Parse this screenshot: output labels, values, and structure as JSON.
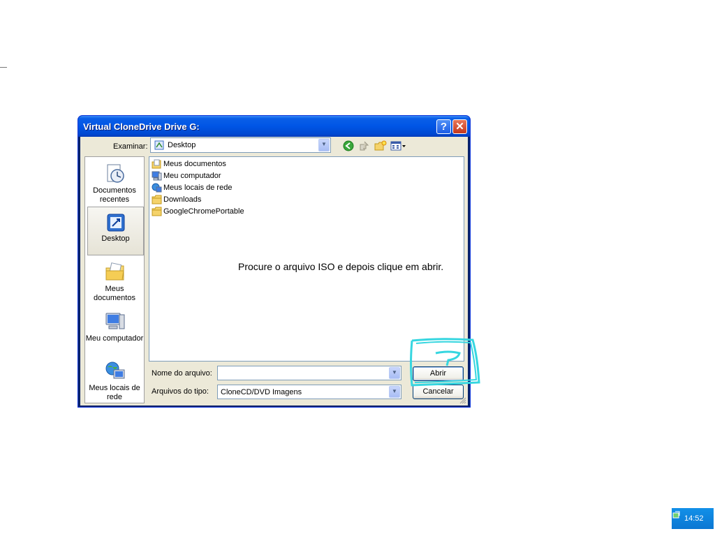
{
  "window": {
    "title": "Virtual CloneDrive Drive G:",
    "help_symbol": "?",
    "close_symbol": "✕"
  },
  "lookin": {
    "label": "Examinar:",
    "value": "Desktop"
  },
  "places": [
    {
      "label": "Documentos recentes",
      "icon": "recent-documents-icon"
    },
    {
      "label": "Desktop",
      "icon": "desktop-icon",
      "selected": true
    },
    {
      "label": "Meus documentos",
      "icon": "my-documents-icon"
    },
    {
      "label": "Meu computador",
      "icon": "my-computer-icon"
    },
    {
      "label": "Meus locais de rede",
      "icon": "network-places-icon"
    }
  ],
  "files": [
    {
      "name": "Meus documentos",
      "icon": "my-documents-icon"
    },
    {
      "name": "Meu computador",
      "icon": "my-computer-icon"
    },
    {
      "name": "Meus locais de rede",
      "icon": "network-places-icon"
    },
    {
      "name": "Downloads",
      "icon": "folder-icon"
    },
    {
      "name": "GoogleChromePortable",
      "icon": "folder-icon"
    }
  ],
  "instruction": "Procure o arquivo ISO e depois clique em abrir.",
  "filename": {
    "label": "Nome do arquivo:",
    "value": ""
  },
  "filetype": {
    "label": "Arquivos do tipo:",
    "value": "CloneCD/DVD Imagens"
  },
  "buttons": {
    "open": "Abrir",
    "cancel": "Cancelar"
  },
  "taskbar": {
    "clock": "14:52"
  },
  "colors": {
    "annotation": "#36d6e0",
    "titlebar": "#0055e5"
  }
}
